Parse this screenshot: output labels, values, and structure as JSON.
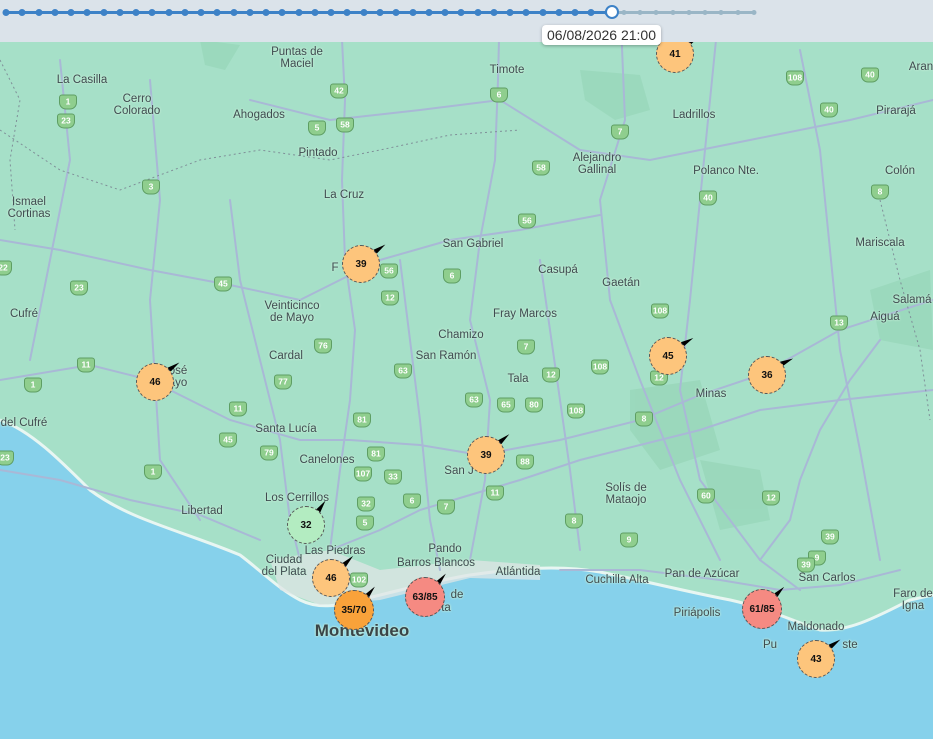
{
  "timeline": {
    "current_datetime": "06/08/2026 21:00",
    "progress": 0.81
  },
  "colors": {
    "land": "#a6e0c8",
    "water": "#86d1eb",
    "road": "#a9b8d6",
    "marker_yellow": "#fdc57c",
    "marker_orange": "#f9a23a",
    "marker_red": "#f58a82",
    "marker_green": "#b3ecc1"
  },
  "place_labels": [
    {
      "name": "Puntas de\nMaciel"
    },
    {
      "name": "Timote"
    },
    {
      "name": "La Casilla"
    },
    {
      "name": "Cerro\nColorado"
    },
    {
      "name": "Ahogados"
    },
    {
      "name": "Ladrillos"
    },
    {
      "name": "Pirarajá"
    },
    {
      "name": "Aran"
    },
    {
      "name": "Pintado"
    },
    {
      "name": "Alejandro\nGallinal"
    },
    {
      "name": "Polanco Nte."
    },
    {
      "name": "Colón"
    },
    {
      "name": "Ismael\nCortinas"
    },
    {
      "name": "La Cruz"
    },
    {
      "name": "San Gabriel"
    },
    {
      "name": "Mariscala"
    },
    {
      "name": "Casupá"
    },
    {
      "name": "Gaetán"
    },
    {
      "name": "Salamá"
    },
    {
      "name": "Aiguá"
    },
    {
      "name": "Cufré"
    },
    {
      "name": "Veinticinco\nde Mayo"
    },
    {
      "name": "Fray Marcos"
    },
    {
      "name": "Chamizo"
    },
    {
      "name": "Cardal"
    },
    {
      "name": "San Ramón"
    },
    {
      "name": "Tala"
    },
    {
      "name": "Minas"
    },
    {
      "name": "Santa Lucía"
    },
    {
      "name": "del Cufré"
    },
    {
      "name": "Canelones"
    },
    {
      "name": "Los Cerrillos"
    },
    {
      "name": "Libertad"
    },
    {
      "name": "Solís de\nMataojo"
    },
    {
      "name": "Pando"
    },
    {
      "name": "Las Piedras"
    },
    {
      "name": "Barros Blancos"
    },
    {
      "name": "Ciudad\ndel Plata"
    },
    {
      "name": "Atlántida"
    },
    {
      "name": "Cuchilla Alta"
    },
    {
      "name": "Pan de Azúcar"
    },
    {
      "name": "San Carlos"
    },
    {
      "name": "Faro de\nIgna"
    },
    {
      "name": "Piriápolis"
    },
    {
      "name": "Maldonado"
    },
    {
      "name": "Montevideo"
    },
    {
      "name": "osé\nayo"
    },
    {
      "name": "San J"
    },
    {
      "name": "de"
    },
    {
      "name": "ta"
    },
    {
      "name": "F"
    },
    {
      "name": "Pu"
    },
    {
      "name": "ste"
    }
  ],
  "route_shields": [
    "42",
    "6",
    "108",
    "40",
    "58",
    "5",
    "7",
    "23",
    "58",
    "3",
    "40",
    "1",
    "40",
    "56",
    "8",
    "22",
    "45",
    "23",
    "6",
    "56",
    "12",
    "108",
    "13",
    "76",
    "11",
    "1",
    "77",
    "7",
    "63",
    "12",
    "108",
    "12",
    "8",
    "11",
    "63",
    "65",
    "80",
    "108",
    "81",
    "45",
    "79",
    "81",
    "107",
    "33",
    "7",
    "88",
    "60",
    "12",
    "1",
    "32",
    "6",
    "5",
    "11",
    "8",
    "39",
    "9",
    "9",
    "102",
    "39",
    "23"
  ],
  "markers": [
    {
      "label": "41",
      "color": "yellow"
    },
    {
      "label": "39",
      "color": "yellow"
    },
    {
      "label": "46",
      "color": "yellow"
    },
    {
      "label": "45",
      "color": "yellow"
    },
    {
      "label": "36",
      "color": "yellow"
    },
    {
      "label": "39",
      "color": "yellow"
    },
    {
      "label": "32",
      "color": "green"
    },
    {
      "label": "46",
      "color": "yellow"
    },
    {
      "label": "35/70",
      "color": "orange"
    },
    {
      "label": "63/85",
      "color": "red"
    },
    {
      "label": "61/85",
      "color": "red"
    },
    {
      "label": "43",
      "color": "yellow"
    }
  ]
}
